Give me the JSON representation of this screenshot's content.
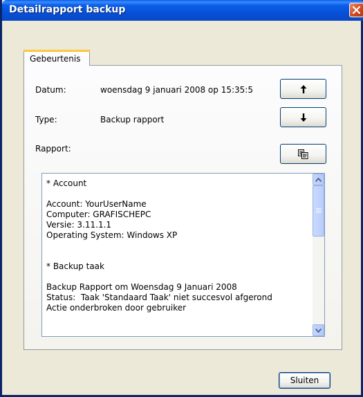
{
  "window": {
    "title": "Detailrapport backup"
  },
  "tabs": [
    {
      "label": "Gebeurtenis",
      "active": true
    }
  ],
  "fields": {
    "datum_label": "Datum:",
    "datum_value": "woensdag 9 januari 2008 op 15:35:5",
    "type_label": "Type:",
    "type_value": "Backup rapport",
    "rapport_label": "Rapport:"
  },
  "buttons": {
    "up_icon": "arrow-up-icon",
    "down_icon": "arrow-down-icon",
    "copy_icon": "copy-icon",
    "close_label": "Sluiten"
  },
  "report": {
    "lines": [
      "* Account",
      "",
      "Account: YourUserName",
      "Computer: GRAFISCHEPC",
      "Versie: 3.11.1.1",
      "Operating System: Windows XP",
      "",
      "",
      "* Backup taak",
      "",
      "Backup Rapport om Woensdag 9 Januari 2008",
      "Status:  Taak 'Standaard Taak' niet succesvol afgerond",
      "Actie onderbroken door gebruiker"
    ]
  },
  "colors": {
    "titlebar": "#0551da",
    "close_button": "#d24a21",
    "tab_highlight": "#ffc83c",
    "button_border": "#003c74"
  }
}
